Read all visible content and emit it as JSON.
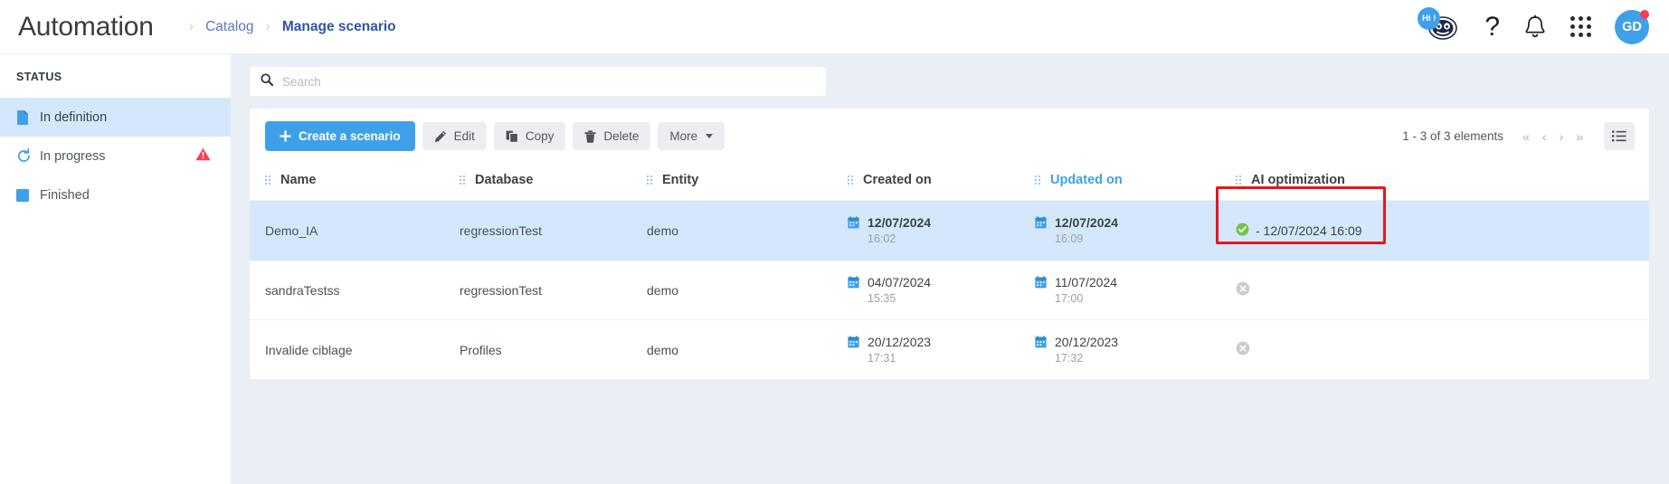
{
  "header": {
    "app_title": "Automation",
    "breadcrumb": [
      {
        "label": "Catalog",
        "active": false
      },
      {
        "label": "Manage scenario",
        "active": true
      }
    ],
    "separator": "›",
    "icons": {
      "bot": "chatbot-icon",
      "bot_badge": "Hi !",
      "help": "?",
      "bell": "bell-icon",
      "apps": "apps-grid-icon",
      "avatar_initials": "GD"
    },
    "accent_color": "#3fa0ea"
  },
  "sidebar": {
    "title": "STATUS",
    "items": [
      {
        "label": "In definition",
        "icon": "document-icon",
        "selected": true,
        "warning": false
      },
      {
        "label": "In progress",
        "icon": "refresh-icon",
        "selected": false,
        "warning": true
      },
      {
        "label": "Finished",
        "icon": "square-icon",
        "selected": false,
        "warning": false
      }
    ]
  },
  "search": {
    "placeholder": "Search",
    "value": "",
    "icon": "search-icon"
  },
  "toolbar": {
    "create_label": "Create a scenario",
    "edit_label": "Edit",
    "copy_label": "Copy",
    "delete_label": "Delete",
    "more_label": "More"
  },
  "pagination": {
    "summary": "1 - 3 of 3 elements",
    "first": "«",
    "prev": "‹",
    "next": "›",
    "last": "»",
    "view_toggle": "list-view-icon"
  },
  "table": {
    "columns": [
      {
        "label": "Name",
        "sorted": false
      },
      {
        "label": "Database",
        "sorted": false
      },
      {
        "label": "Entity",
        "sorted": false
      },
      {
        "label": "Created on",
        "sorted": false
      },
      {
        "label": "Updated on",
        "sorted": true
      },
      {
        "label": "AI optimization",
        "sorted": false
      }
    ],
    "rows": [
      {
        "name": "Demo_IA",
        "database": "regressionTest",
        "entity": "demo",
        "created_date": "12/07/2024",
        "created_time": "16:02",
        "updated_date": "12/07/2024",
        "updated_time": "16:09",
        "ai_status": "ok",
        "ai_text": "- 12/07/2024 16:09",
        "selected": true,
        "highlighted": true
      },
      {
        "name": "sandraTestss",
        "database": "regressionTest",
        "entity": "demo",
        "created_date": "04/07/2024",
        "created_time": "15:35",
        "updated_date": "11/07/2024",
        "updated_time": "17:00",
        "ai_status": "none",
        "ai_text": "",
        "selected": false,
        "highlighted": false
      },
      {
        "name": "Invalide ciblage",
        "database": "Profiles",
        "entity": "demo",
        "created_date": "20/12/2023",
        "created_time": "17:31",
        "updated_date": "20/12/2023",
        "updated_time": "17:32",
        "ai_status": "none",
        "ai_text": "",
        "selected": false,
        "highlighted": false
      }
    ]
  },
  "colors": {
    "accent": "#3fa0ea",
    "selected_row": "#d5e8fb",
    "background": "#eaeef5",
    "highlight_box": "#e8161d",
    "success": "#6fc44a",
    "warning": "#f8424f"
  }
}
